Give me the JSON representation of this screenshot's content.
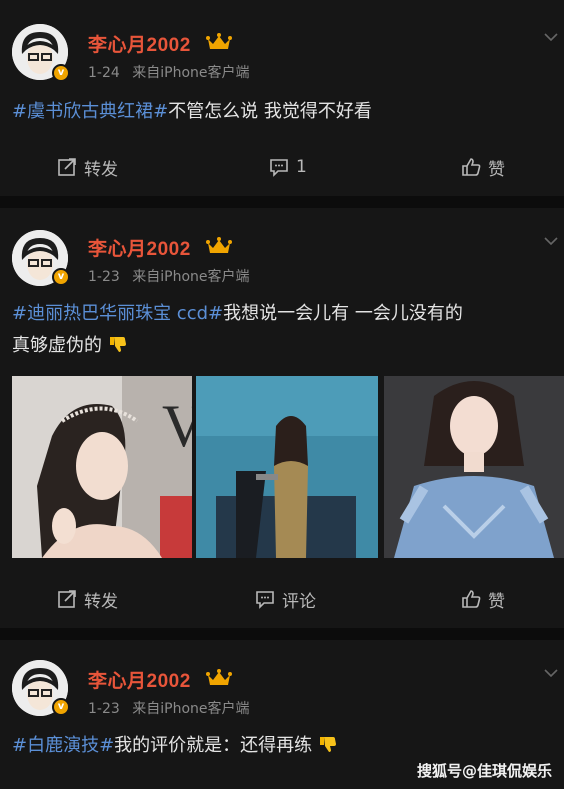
{
  "posts": [
    {
      "username": "李心月2002",
      "time": "1-24",
      "source": "来自iPhone客户端",
      "hashtag": "#虞书欣古典红裙#",
      "text": "不管怎么说 我觉得不好看",
      "actions": {
        "repost": "转发",
        "comment": "1",
        "like": "赞"
      }
    },
    {
      "username": "李心月2002",
      "time": "1-23",
      "source": "来自iPhone客户端",
      "hashtag": "#迪丽热巴华丽珠宝 ccd#",
      "text_line1": "我想说一会儿有 一会儿没有的",
      "text_line2": "真够虚伪的",
      "actions": {
        "repost": "转发",
        "comment": "评论",
        "like": "赞"
      }
    },
    {
      "username": "李心月2002",
      "time": "1-23",
      "source": "来自iPhone客户端",
      "hashtag": "#白鹿演技#",
      "text": "我的评价就是：还得再练"
    }
  ],
  "watermark": "搜狐号@佳琪侃娱乐",
  "colors": {
    "username": "#e8553a",
    "hashtag": "#5b8fd6",
    "background": "#161616",
    "badge": "#f0a400"
  }
}
